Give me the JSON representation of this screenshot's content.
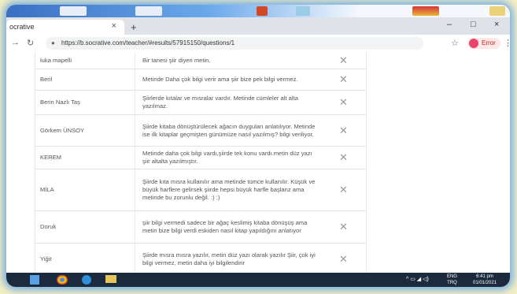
{
  "browser": {
    "tab_title": "ocrative",
    "tab_close": "×",
    "new_tab": "+",
    "minimize": "–",
    "maximize": "□",
    "close": "×",
    "url": "https://b.socrative.com/teacher/#results/57915150/questions/1",
    "error_label": "Error"
  },
  "rows": [
    {
      "name": "luka mapelli",
      "comment": "Bir tanesi şiir diyeri metin."
    },
    {
      "name": "Beril",
      "comment": "Metinde Daha çok bilgi verir ama şiir bize pek bilgi vermez."
    },
    {
      "name": "Berin Nazlı Taş",
      "comment": "Şiirlerde kıtalar ve mısralar vardır. Metinde cümleler alt alta yazılmaz."
    },
    {
      "name": "Görkem ÜNSOY",
      "comment": "Şiirde kitaba dönüştürülecek ağacın duyguları anlatılıyor. Metinde ise ilk kitaplar geçmişten günümüze nasıl yazılmış? bilgi veriliyor."
    },
    {
      "name": "KEREM",
      "comment": "Metinde daha çok bilgi vardı,şiirde tek konu vardı.metin düz yazı şiir altalta yazılmıştır."
    },
    {
      "name": "MİLA",
      "comment": "Şiirde kıta mısra kullanılır ama metinde tümce kullanılır. Küşük ve büyük harflere gelirsek şiirde hepsi büyük harfle başlanz ama metinde bu zorunlu değil. :) :)"
    },
    {
      "name": "Doruk",
      "comment": "şiir bilgi vermedi sadece bir ağaç keslimiş kitaba dönüşüş ama metin bize bilgi verdi eskiden nasıl kitap yapıldığını anlatıyor"
    },
    {
      "name": "Yiğit",
      "comment": "Şiirde mısra mısra yazılır, metin düz yazı olarak yazılır Şiir, çok iyi bilgi vermez, metin daha iyi bilgilendirir"
    }
  ],
  "taskbar": {
    "lang_top": "ENG",
    "lang_bottom": "TRQ",
    "time": "6:41 pm",
    "date": "01/01/2021"
  },
  "colors": {
    "background": "#f6efc4",
    "glow": "#5aa0e6",
    "taskbar": "#1c2a3d"
  }
}
